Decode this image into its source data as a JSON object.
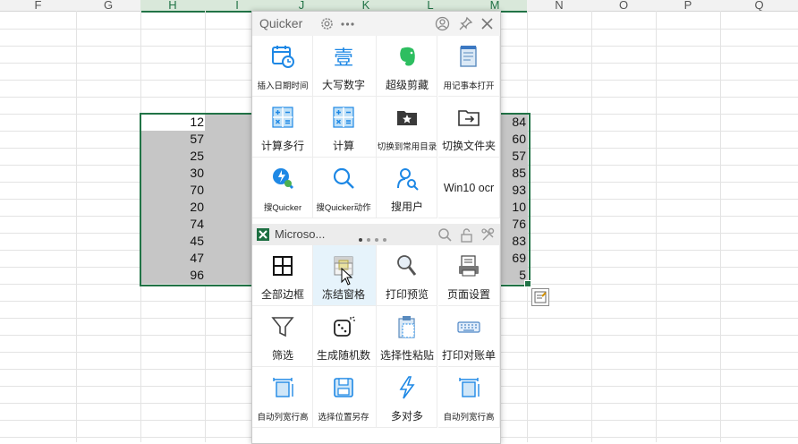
{
  "spreadsheet": {
    "columns": [
      "F",
      "G",
      "H",
      "I",
      "J",
      "K",
      "L",
      "M",
      "N",
      "O",
      "P",
      "Q"
    ],
    "left_values": [
      "12",
      "57",
      "25",
      "30",
      "70",
      "20",
      "74",
      "45",
      "47",
      "96"
    ],
    "right_values": [
      "84",
      "60",
      "57",
      "85",
      "93",
      "10",
      "76",
      "83",
      "69",
      "5"
    ],
    "accent_color": "#217346"
  },
  "quicker": {
    "title": "Quicker",
    "context_title": "Microso...",
    "top_actions": [
      {
        "label": "插入日期时间",
        "icon": "calendar-clock-icon"
      },
      {
        "label": "大写数字",
        "icon": "chinese-numeral-icon",
        "glyph": "壹"
      },
      {
        "label": "超级剪藏",
        "icon": "evernote-icon"
      },
      {
        "label": "用记事本打开",
        "icon": "notepad-icon"
      },
      {
        "label": "计算多行",
        "icon": "calculator-icon"
      },
      {
        "label": "计算",
        "icon": "calculator-icon"
      },
      {
        "label": "切换到常用目录",
        "icon": "folder-star-icon"
      },
      {
        "label": "切换文件夹",
        "icon": "folder-arrow-icon"
      },
      {
        "label": "搜Quicker",
        "icon": "quicker-search-icon"
      },
      {
        "label": "搜Quicker动作",
        "icon": "magnifier-icon"
      },
      {
        "label": "搜用户",
        "icon": "user-search-icon"
      },
      {
        "label": "Win10 ocr",
        "icon": ""
      }
    ],
    "context_actions": [
      {
        "label": "全部边框",
        "icon": "all-borders-icon"
      },
      {
        "label": "冻结窗格",
        "icon": "freeze-panes-icon"
      },
      {
        "label": "打印预览",
        "icon": "print-preview-icon"
      },
      {
        "label": "页面设置",
        "icon": "page-setup-icon"
      },
      {
        "label": "筛选",
        "icon": "filter-icon"
      },
      {
        "label": "生成随机数",
        "icon": "dice-icon"
      },
      {
        "label": "选择性粘贴",
        "icon": "paste-special-icon"
      },
      {
        "label": "打印对账单",
        "icon": "keyboard-icon"
      },
      {
        "label": "自动列宽行高",
        "icon": "autofit-icon"
      },
      {
        "label": "选择位置另存",
        "icon": "save-icon"
      },
      {
        "label": "多对多",
        "icon": "lightning-icon"
      },
      {
        "label": "自动列宽行高",
        "icon": "autofit-icon"
      }
    ]
  }
}
